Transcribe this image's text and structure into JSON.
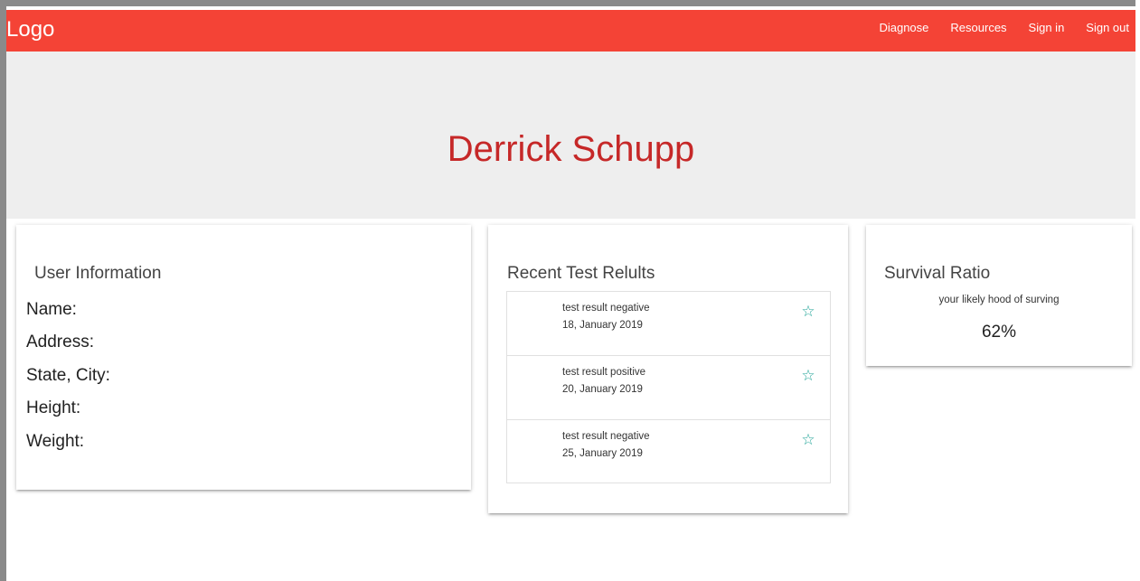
{
  "navbar": {
    "brand": "Logo",
    "links": [
      "Diagnose",
      "Resources",
      "Sign in",
      "Sign out"
    ],
    "color": "#f44336"
  },
  "hero": {
    "name": "Derrick Schupp",
    "name_color": "#c62828",
    "background": "#eeeeee"
  },
  "user_info": {
    "title": "User Information",
    "fields": [
      "Name:",
      "Address:",
      "State, City:",
      "Height:",
      "Weight:"
    ]
  },
  "tests": {
    "title": "Recent Test Relults",
    "items": [
      {
        "result": "test result negative",
        "date": "18, January 2019",
        "icon": "star-outline-icon"
      },
      {
        "result": "test result positive",
        "date": "20, January 2019",
        "icon": "star-outline-icon"
      },
      {
        "result": "test result negative",
        "date": "25, January 2019",
        "icon": "star-outline-icon"
      }
    ],
    "star_color": "#26a69a"
  },
  "survival": {
    "title": "Survival Ratio",
    "subtitle": "your likely hood of surving",
    "percentage": "62%"
  }
}
